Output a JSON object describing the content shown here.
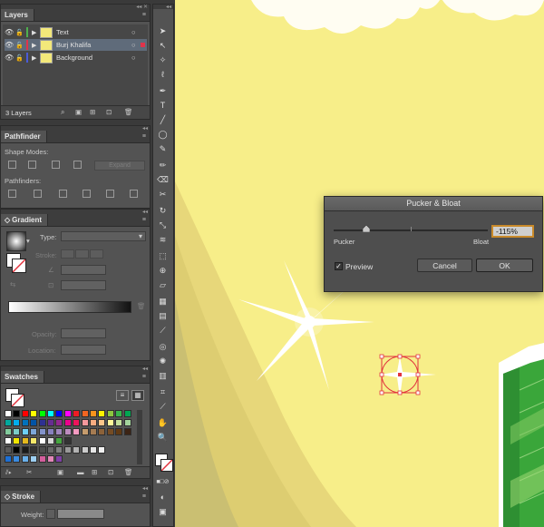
{
  "layers_panel": {
    "tab": "Layers",
    "layers": [
      {
        "name": "Text",
        "color": "#4fb04f"
      },
      {
        "name": "Burj Khalifa",
        "color": "#e0334a"
      },
      {
        "name": "Background",
        "color": "#4b5bd8"
      }
    ],
    "count_label": "3 Layers"
  },
  "pathfinder_panel": {
    "tab": "Pathfinder",
    "shape_modes_label": "Shape Modes:",
    "expand_label": "Expand",
    "pathfinders_label": "Pathfinders:"
  },
  "gradient_panel": {
    "tab": "Gradient",
    "type_label": "Type:",
    "stroke_label": "Stroke:",
    "opacity_label": "Opacity:",
    "location_label": "Location:"
  },
  "swatches_panel": {
    "tab": "Swatches",
    "rows": [
      [
        "#ffffff",
        "#000000",
        "#ff0000",
        "#ffff00",
        "#00ff00",
        "#00ffff",
        "#0000ff",
        "#ff00ff",
        "#ed1c24",
        "#f26522",
        "#f7941d",
        "#fff200",
        "#8dc63f",
        "#39b54a",
        "#00a651"
      ],
      [
        "#00a99d",
        "#00aeef",
        "#0072bc",
        "#0054a6",
        "#2e3192",
        "#662d91",
        "#92278f",
        "#ec008c",
        "#ed145b",
        "#f5989d",
        "#f9ad81",
        "#fdc68a",
        "#fff799",
        "#c4df9b",
        "#a3d39c"
      ],
      [
        "#82ca9c",
        "#7accc8",
        "#6dcff6",
        "#7da7d9",
        "#8393ca",
        "#8781bd",
        "#a186be",
        "#bd8cbf",
        "#f49ac1",
        "#c69c6d",
        "#a67c52",
        "#8c6239",
        "#754c24",
        "#603913",
        "#3c2415"
      ],
      [
        "#ffffff",
        "#f2e600",
        "#e4b81d",
        "#f5e86a",
        "#ffffff",
        "#d9d9d9",
        "#45a63f",
        "#333333"
      ],
      [
        "#5a5a5a",
        "#000000",
        "#1a1a1a",
        "#333333",
        "#4d4d4d",
        "#666666",
        "#808080",
        "#999999",
        "#b3b3b3",
        "#cccccc",
        "#e6e6e6",
        "#f2f2f2"
      ],
      [
        "#1d6fd4",
        "#3a8be0",
        "#6ab0ea",
        "#9dcff2",
        "#d45e9c",
        "#e287b8",
        "#7f3fa6"
      ]
    ]
  },
  "stroke_panel": {
    "tab": "Stroke",
    "weight_label": "Weight:"
  },
  "dialog": {
    "title": "Pucker & Bloat",
    "left_label": "Pucker",
    "right_label": "Bloat",
    "value": "-115%",
    "slider_value": -115,
    "slider_range": [
      -200,
      200
    ],
    "preview_label": "Preview",
    "preview_checked": true,
    "cancel_label": "Cancel",
    "ok_label": "OK"
  },
  "colors": {
    "canvas": "#f7ee89",
    "panel": "#535353",
    "artboard_green": "#3aa63a",
    "selection": "#e2333d"
  }
}
